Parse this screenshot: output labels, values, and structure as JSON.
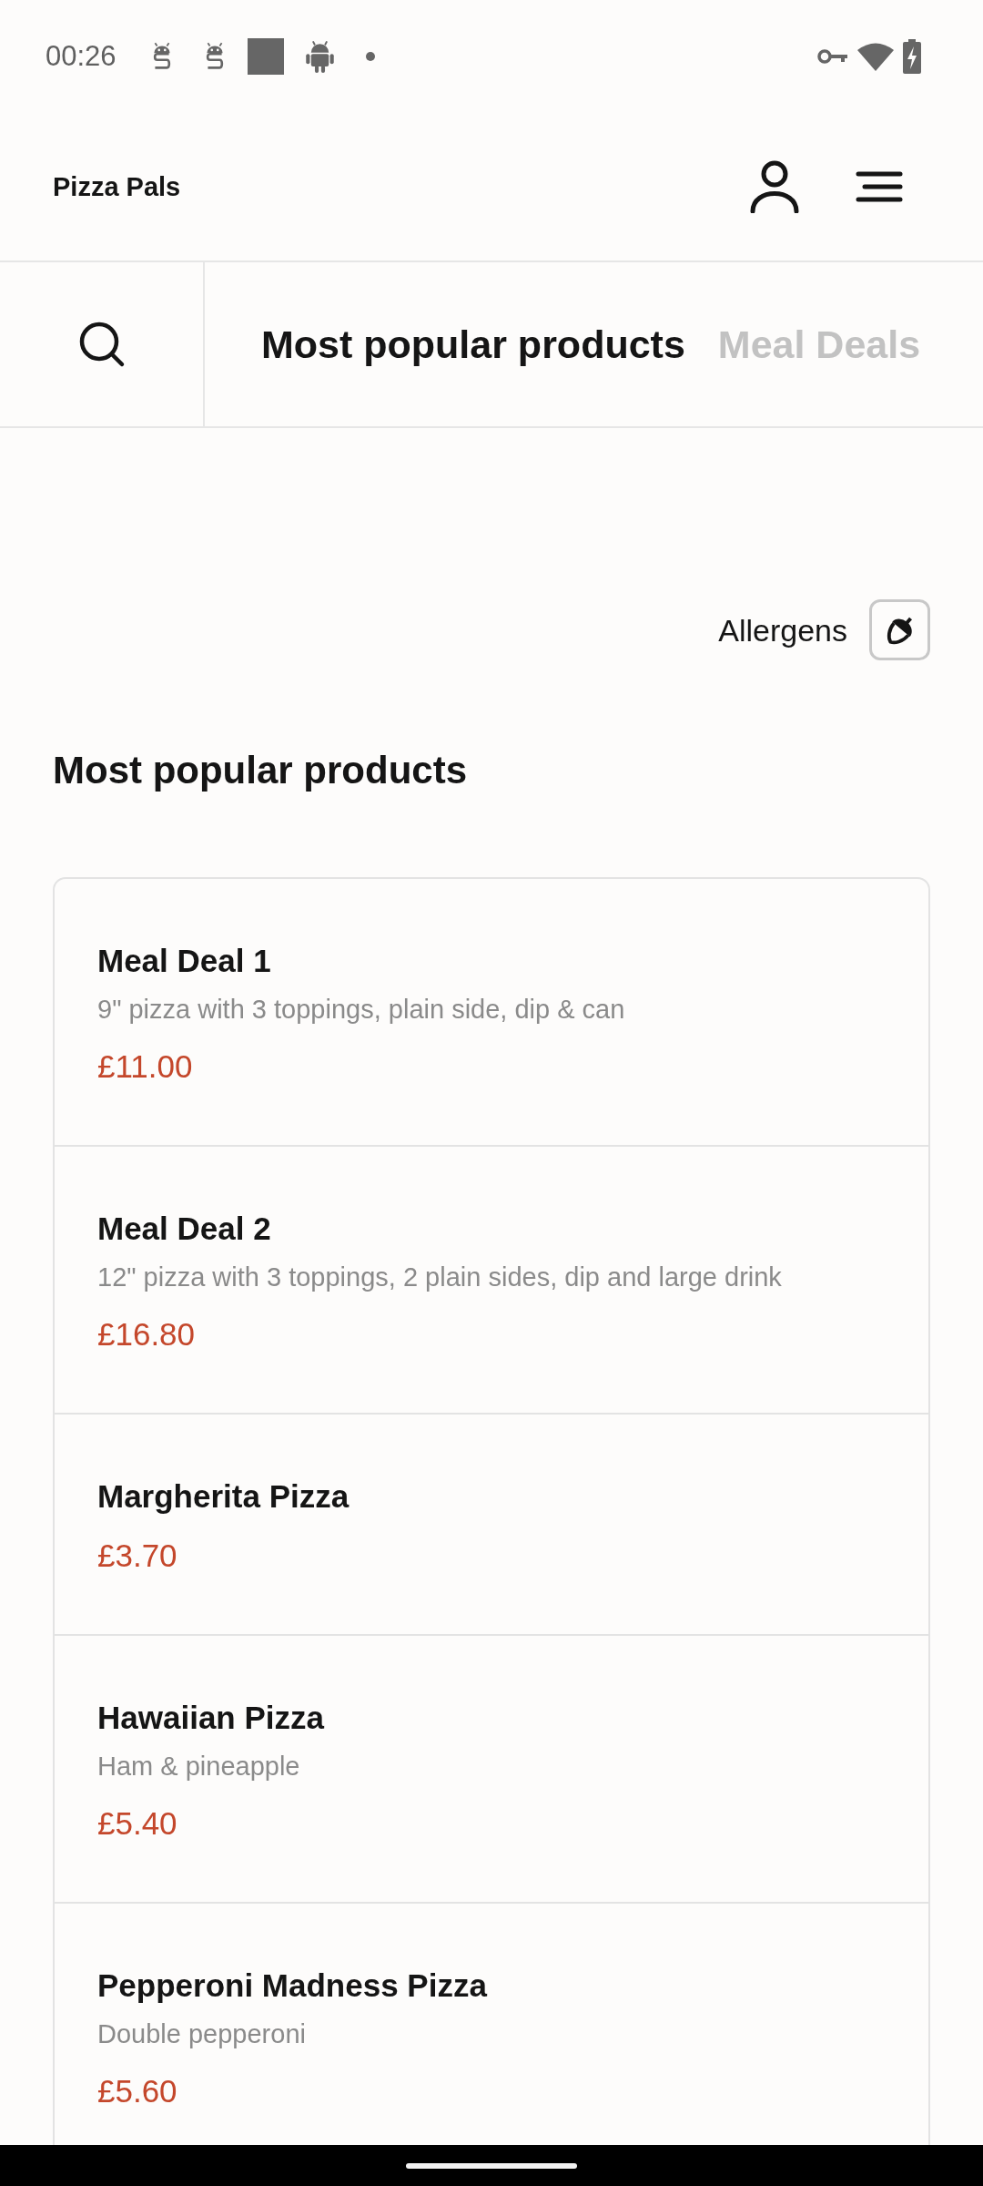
{
  "status_bar": {
    "time": "00:26"
  },
  "header": {
    "title": "Pizza Pals"
  },
  "category_tabs": [
    {
      "label": "Most popular products",
      "selected": true
    },
    {
      "label": "Meal Deals",
      "selected": false
    }
  ],
  "allergens": {
    "label": "Allergens"
  },
  "section": {
    "title": "Most popular products",
    "products": [
      {
        "name": "Meal Deal 1",
        "description": "9\" pizza with 3 toppings, plain side, dip & can",
        "price": "£11.00"
      },
      {
        "name": "Meal Deal 2",
        "description": "12\" pizza with 3 toppings, 2 plain sides, dip and large drink",
        "price": "£16.80"
      },
      {
        "name": "Margherita Pizza",
        "price": "£3.70"
      },
      {
        "name": "Hawaiian Pizza",
        "description": "Ham & pineapple",
        "price": "£5.40"
      },
      {
        "name": "Pepperoni Madness Pizza",
        "description": "Double pepperoni",
        "price": "£5.60"
      }
    ]
  }
}
